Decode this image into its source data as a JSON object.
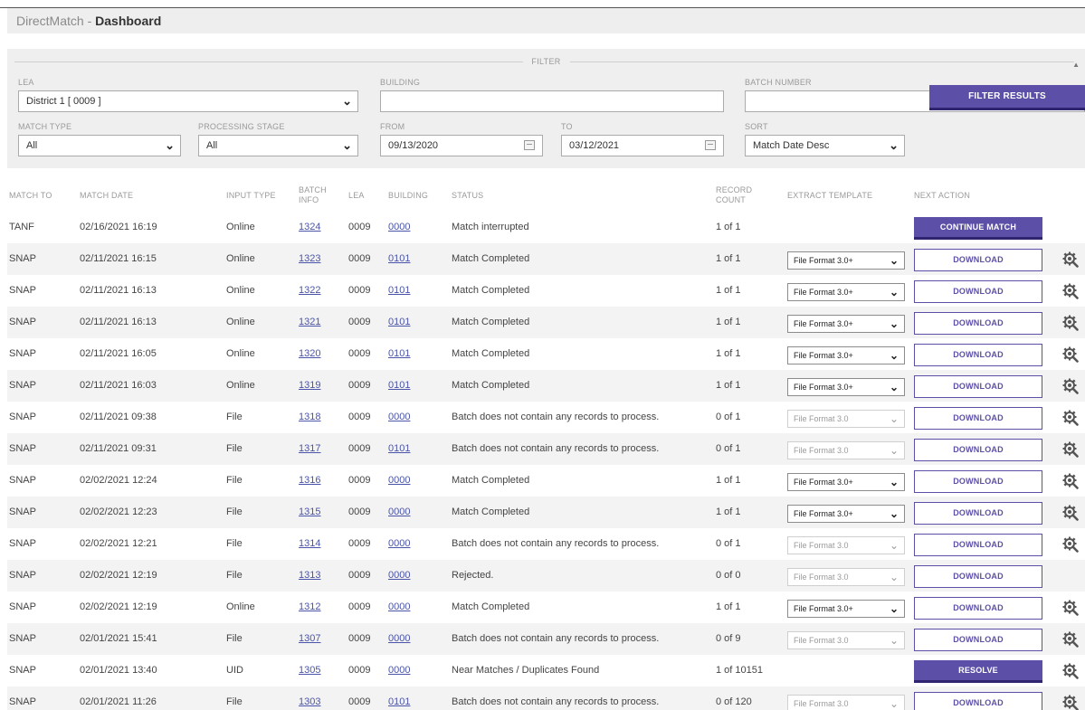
{
  "header": {
    "app_name": "DirectMatch",
    "separator": " - ",
    "page_title": "Dashboard"
  },
  "filter": {
    "legend": "FILTER",
    "lea_label": "LEA",
    "lea_value": "District 1 [ 0009 ]",
    "building_label": "BUILDING",
    "building_value": "",
    "batch_label": "BATCH NUMBER",
    "batch_value": "",
    "match_type_label": "MATCH TYPE",
    "match_type_value": "All",
    "stage_label": "PROCESSING STAGE",
    "stage_value": "All",
    "from_label": "FROM",
    "from_value": "09/13/2020",
    "to_label": "TO",
    "to_value": "03/12/2021",
    "sort_label": "SORT",
    "sort_value": "Match Date Desc",
    "button": "FILTER RESULTS"
  },
  "table": {
    "columns": {
      "match_to": "MATCH TO",
      "match_date": "MATCH DATE",
      "input_type": "INPUT TYPE",
      "batch_info_1": "BATCH",
      "batch_info_2": "INFO",
      "lea": "LEA",
      "building": "BUILDING",
      "status": "STATUS",
      "record_count_1": "RECORD",
      "record_count_2": "COUNT",
      "extract_template": "EXTRACT TEMPLATE",
      "next_action": "NEXT ACTION"
    },
    "rows": [
      {
        "match_to": "TANF",
        "date": "02/16/2021 16:19",
        "input": "Online",
        "batch": "1324",
        "lea": "0009",
        "building": "0000",
        "status": "Match interrupted",
        "count": "1 of 1",
        "template": "",
        "template_enabled": false,
        "action": "CONTINUE MATCH",
        "action_style": "filled",
        "gear": false
      },
      {
        "match_to": "SNAP",
        "date": "02/11/2021 16:15",
        "input": "Online",
        "batch": "1323",
        "lea": "0009",
        "building": "0101",
        "status": "Match Completed",
        "count": "1 of 1",
        "template": "File Format 3.0+",
        "template_enabled": true,
        "action": "DOWNLOAD",
        "action_style": "outline",
        "gear": true
      },
      {
        "match_to": "SNAP",
        "date": "02/11/2021 16:13",
        "input": "Online",
        "batch": "1322",
        "lea": "0009",
        "building": "0101",
        "status": "Match Completed",
        "count": "1 of 1",
        "template": "File Format 3.0+",
        "template_enabled": true,
        "action": "DOWNLOAD",
        "action_style": "outline",
        "gear": true
      },
      {
        "match_to": "SNAP",
        "date": "02/11/2021 16:13",
        "input": "Online",
        "batch": "1321",
        "lea": "0009",
        "building": "0101",
        "status": "Match Completed",
        "count": "1 of 1",
        "template": "File Format 3.0+",
        "template_enabled": true,
        "action": "DOWNLOAD",
        "action_style": "outline",
        "gear": true
      },
      {
        "match_to": "SNAP",
        "date": "02/11/2021 16:05",
        "input": "Online",
        "batch": "1320",
        "lea": "0009",
        "building": "0101",
        "status": "Match Completed",
        "count": "1 of 1",
        "template": "File Format 3.0+",
        "template_enabled": true,
        "action": "DOWNLOAD",
        "action_style": "outline",
        "gear": true
      },
      {
        "match_to": "SNAP",
        "date": "02/11/2021 16:03",
        "input": "Online",
        "batch": "1319",
        "lea": "0009",
        "building": "0101",
        "status": "Match Completed",
        "count": "1 of 1",
        "template": "File Format 3.0+",
        "template_enabled": true,
        "action": "DOWNLOAD",
        "action_style": "outline",
        "gear": true
      },
      {
        "match_to": "SNAP",
        "date": "02/11/2021 09:38",
        "input": "File",
        "batch": "1318",
        "lea": "0009",
        "building": "0000",
        "status": "Batch does not contain any records to process.",
        "count": "0 of 1",
        "template": "File Format 3.0",
        "template_enabled": false,
        "action": "DOWNLOAD",
        "action_style": "outline",
        "gear": true
      },
      {
        "match_to": "SNAP",
        "date": "02/11/2021 09:31",
        "input": "File",
        "batch": "1317",
        "lea": "0009",
        "building": "0101",
        "status": "Batch does not contain any records to process.",
        "count": "0 of 1",
        "template": "File Format 3.0",
        "template_enabled": false,
        "action": "DOWNLOAD",
        "action_style": "outline",
        "gear": true
      },
      {
        "match_to": "SNAP",
        "date": "02/02/2021 12:24",
        "input": "File",
        "batch": "1316",
        "lea": "0009",
        "building": "0000",
        "status": "Match Completed",
        "count": "1 of 1",
        "template": "File Format 3.0+",
        "template_enabled": true,
        "action": "DOWNLOAD",
        "action_style": "outline",
        "gear": true
      },
      {
        "match_to": "SNAP",
        "date": "02/02/2021 12:23",
        "input": "File",
        "batch": "1315",
        "lea": "0009",
        "building": "0000",
        "status": "Match Completed",
        "count": "1 of 1",
        "template": "File Format 3.0+",
        "template_enabled": true,
        "action": "DOWNLOAD",
        "action_style": "outline",
        "gear": true
      },
      {
        "match_to": "SNAP",
        "date": "02/02/2021 12:21",
        "input": "File",
        "batch": "1314",
        "lea": "0009",
        "building": "0000",
        "status": "Batch does not contain any records to process.",
        "count": "0 of 1",
        "template": "File Format 3.0",
        "template_enabled": false,
        "action": "DOWNLOAD",
        "action_style": "outline",
        "gear": true
      },
      {
        "match_to": "SNAP",
        "date": "02/02/2021 12:19",
        "input": "File",
        "batch": "1313",
        "lea": "0009",
        "building": "0000",
        "status": "Rejected.",
        "count": "0 of 0",
        "template": "File Format 3.0",
        "template_enabled": false,
        "action": "DOWNLOAD",
        "action_style": "outline",
        "gear": false
      },
      {
        "match_to": "SNAP",
        "date": "02/02/2021 12:19",
        "input": "Online",
        "batch": "1312",
        "lea": "0009",
        "building": "0000",
        "status": "Match Completed",
        "count": "1 of 1",
        "template": "File Format 3.0+",
        "template_enabled": true,
        "action": "DOWNLOAD",
        "action_style": "outline",
        "gear": true
      },
      {
        "match_to": "SNAP",
        "date": "02/01/2021 15:41",
        "input": "File",
        "batch": "1307",
        "lea": "0009",
        "building": "0000",
        "status": "Batch does not contain any records to process.",
        "count": "0 of 9",
        "template": "File Format 3.0",
        "template_enabled": false,
        "action": "DOWNLOAD",
        "action_style": "outline",
        "gear": true
      },
      {
        "match_to": "SNAP",
        "date": "02/01/2021 13:40",
        "input": "UID",
        "batch": "1305",
        "lea": "0009",
        "building": "0000",
        "status": "Near Matches / Duplicates Found",
        "count": "1 of 10151",
        "template": "",
        "template_enabled": false,
        "action": "RESOLVE",
        "action_style": "filled",
        "gear": true
      },
      {
        "match_to": "SNAP",
        "date": "02/01/2021 11:26",
        "input": "File",
        "batch": "1303",
        "lea": "0009",
        "building": "0101",
        "status": "Batch does not contain any records to process.",
        "count": "0 of 120",
        "template": "File Format 3.0",
        "template_enabled": false,
        "action": "DOWNLOAD",
        "action_style": "outline",
        "gear": true
      }
    ]
  },
  "icons": {
    "gear": "gear-search-icon",
    "calendar": "calendar-icon",
    "caret": "chevron-down-icon"
  },
  "colors": {
    "accent": "#5b4fa8",
    "accent_dark": "#2e2470",
    "link": "#4a54a8"
  }
}
